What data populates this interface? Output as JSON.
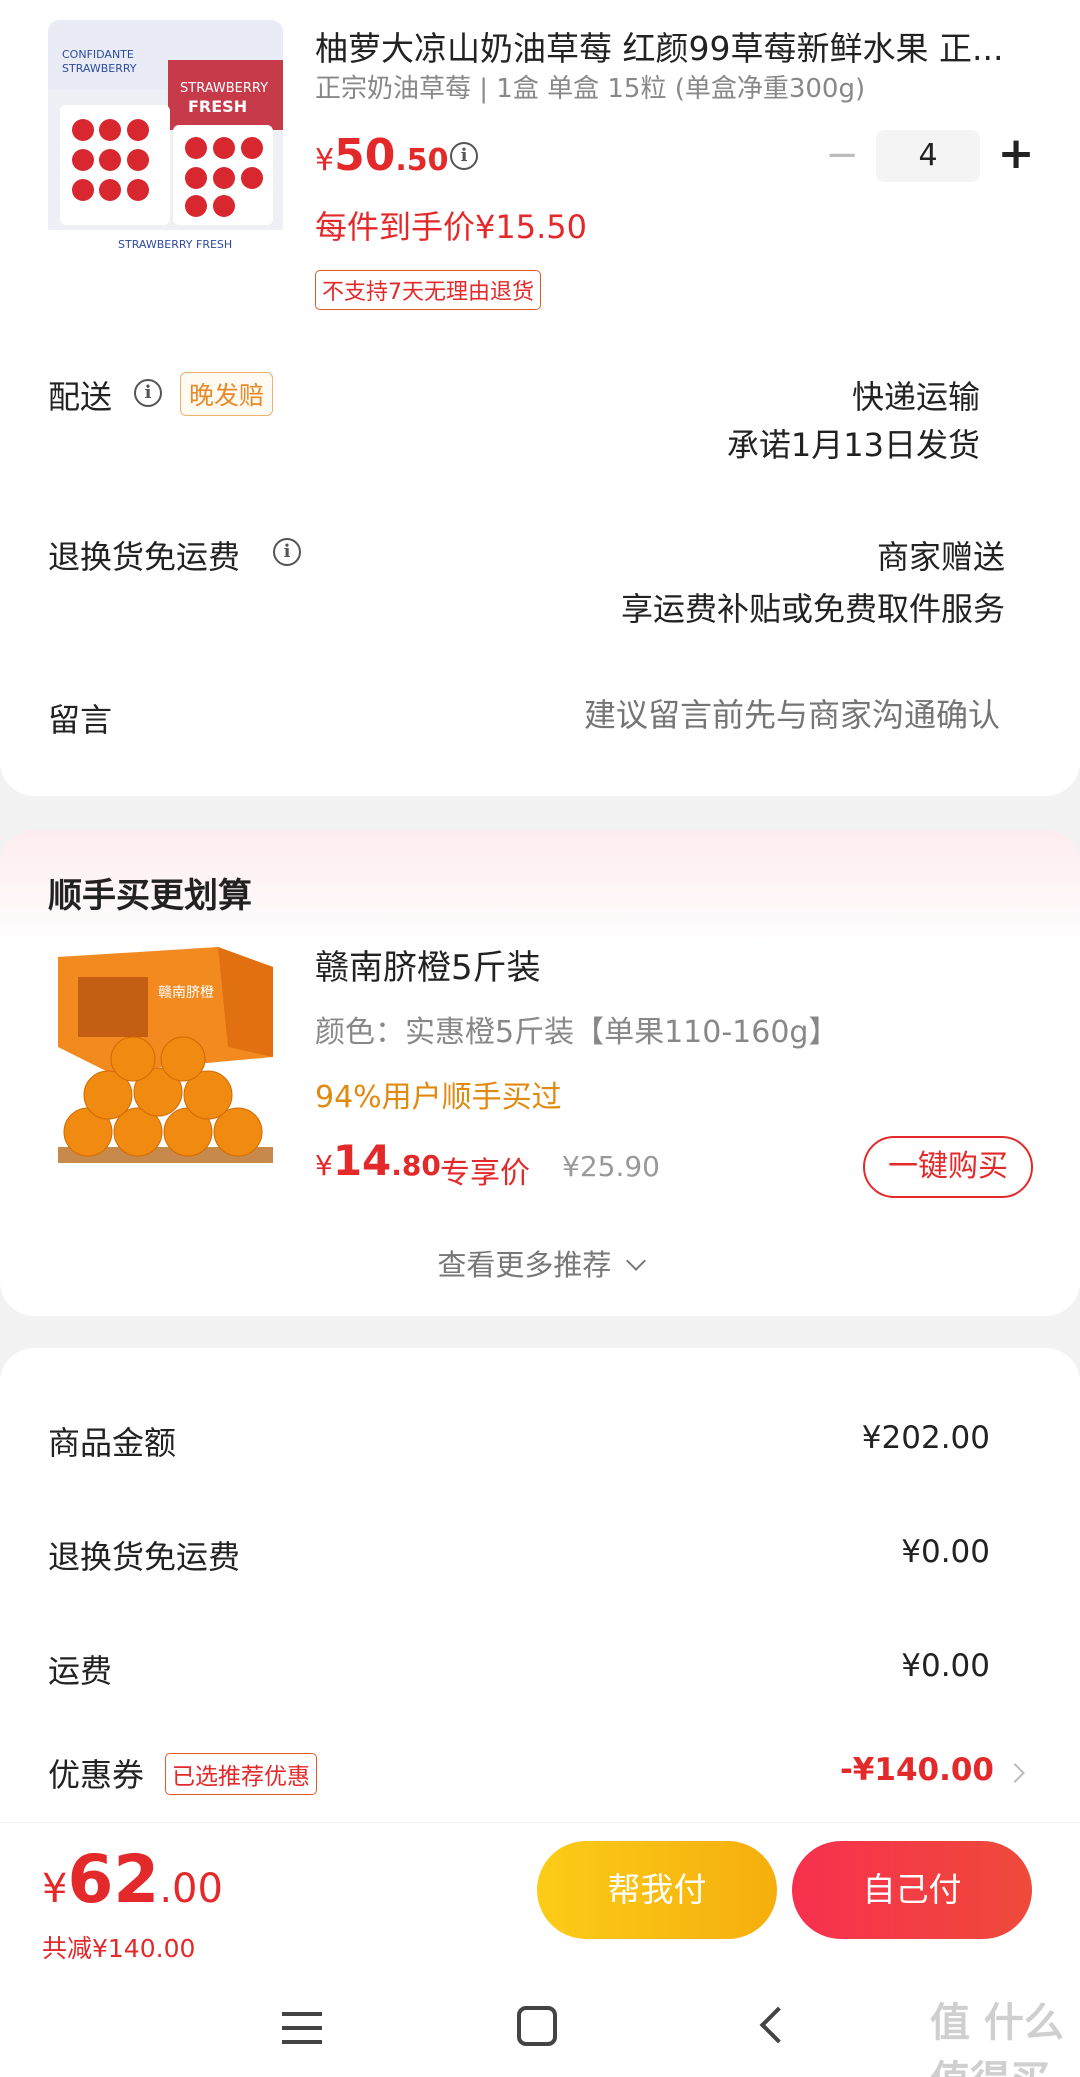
{
  "product": {
    "title": "柚萝大凉山奶油草莓 红颜99草莓新鲜水果 正...",
    "spec": "正宗奶油草莓 | 1盒 单盒 15粒 (单盒净重300g)",
    "price_symbol": "¥",
    "price_int": "50",
    "price_dec": ".50",
    "unit_price": "每件到手价¥15.50",
    "return_tag": "不支持7天无理由退货",
    "qty_minus": "−",
    "qty": "4",
    "qty_plus": "+",
    "image_lines": [
      "CONFIDANTE",
      "STRAWBERRY",
      "STRAWBERRY",
      "FRESH"
    ]
  },
  "delivery": {
    "label": "配送",
    "tag": "晚发赔",
    "method": "快递运输",
    "promise": "承诺1月13日发货"
  },
  "return_freight": {
    "label": "退换货免运费",
    "value": "商家赠送",
    "desc": "享运费补贴或免费取件服务"
  },
  "message": {
    "label": "留言",
    "placeholder": "建议留言前先与商家沟通确认"
  },
  "recommend": {
    "section_title": "顺手买更划算",
    "title": "赣南脐橙5斤装",
    "color": "颜色：实惠橙5斤装【单果110-160g】",
    "bought": "94%用户顺手买过",
    "price_symbol": "¥",
    "price_int": "14",
    "price_dec": ".80",
    "price_tag": "专享价",
    "orig_price": "¥25.90",
    "buy_button": "一键购买",
    "more": "查看更多推荐",
    "box_label": "赣南脐橙"
  },
  "summary": {
    "rows": [
      {
        "label": "商品金额",
        "value": "¥202.00"
      },
      {
        "label": "退换货免运费",
        "value": "¥0.00"
      },
      {
        "label": "运费",
        "value": "¥0.00"
      }
    ],
    "coupon_label": "优惠券",
    "coupon_tag": "已选推荐优惠",
    "coupon_value": "-¥140.00"
  },
  "footer": {
    "total_symbol": "¥",
    "total_int": "62",
    "total_dec": ".00",
    "saved": "共减¥140.00",
    "help_pay": "帮我付",
    "self_pay": "自己付"
  },
  "watermark": "值 什么值得买",
  "colors": {
    "accent_red": "#e4292a",
    "orange": "#f5b00f",
    "pink_red": "#f23a4a"
  }
}
